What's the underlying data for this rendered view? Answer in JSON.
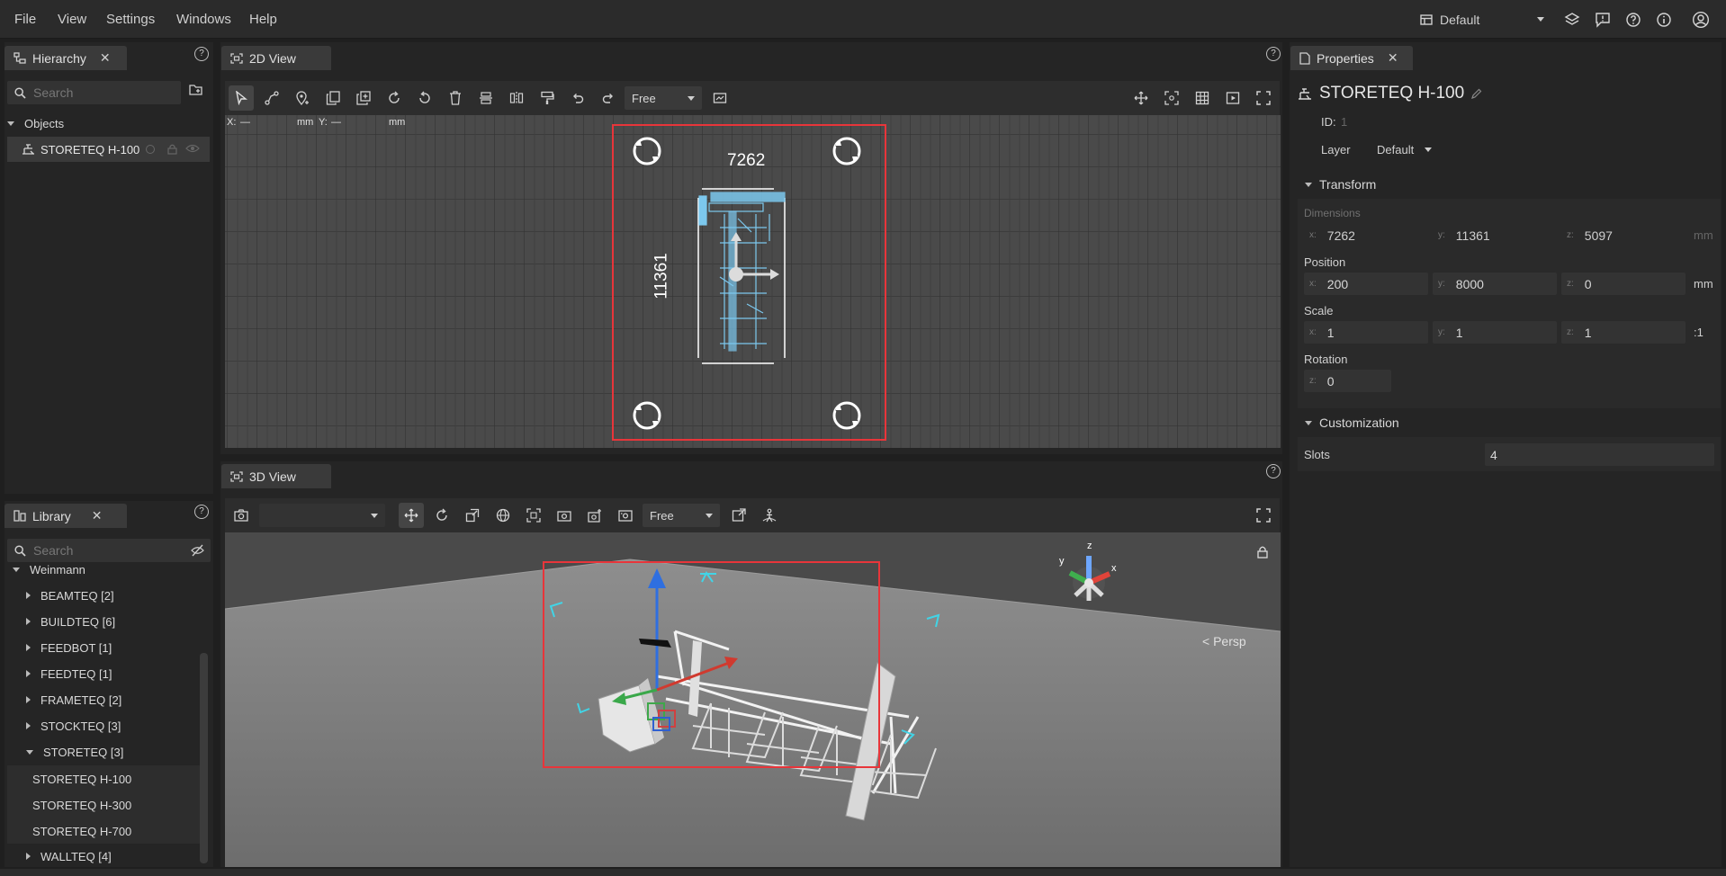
{
  "menubar": {
    "items": [
      "File",
      "View",
      "Settings",
      "Windows",
      "Help"
    ],
    "layout_label": "Default"
  },
  "hierarchy": {
    "tab_label": "Hierarchy",
    "search_placeholder": "Search",
    "group_label": "Objects",
    "items": [
      {
        "label": "STORETEQ H-100"
      }
    ]
  },
  "library": {
    "tab_label": "Library",
    "search_placeholder": "Search",
    "parent_label": "Weinmann",
    "groups": [
      {
        "label": "BEAMTEQ [2]"
      },
      {
        "label": "BUILDTEQ [6]"
      },
      {
        "label": "FEEDBOT [1]"
      },
      {
        "label": "FEEDTEQ [1]"
      },
      {
        "label": "FRAMETEQ [2]"
      },
      {
        "label": "STOCKTEQ [3]"
      },
      {
        "label": "STORETEQ [3]"
      }
    ],
    "children": [
      "STORETEQ H-100",
      "STORETEQ H-300",
      "STORETEQ H-700"
    ],
    "last_group": "WALLTEQ [4]"
  },
  "view2d": {
    "tab_label": "2D View",
    "mode_label": "Free",
    "coords": {
      "x_label": "X:",
      "x_value": "—",
      "x_unit": "mm",
      "y_label": "Y:",
      "y_value": "—",
      "y_unit": "mm"
    },
    "dim_width": "7262",
    "dim_height": "11361"
  },
  "view3d": {
    "tab_label": "3D View",
    "camera_value": "",
    "mode_label": "Free",
    "gizmo_axis_x": "x",
    "gizmo_axis_y": "y",
    "gizmo_axis_z": "z",
    "persp_label": "< Persp"
  },
  "properties": {
    "tab_label": "Properties",
    "title": "STORETEQ H-100",
    "id_label": "ID:",
    "id_value": "1",
    "layer_label": "Layer",
    "layer_value": "Default",
    "transform_label": "Transform",
    "dimensions_label": "Dimensions",
    "dimensions": {
      "x": "7262",
      "y": "11361",
      "z": "5097",
      "unit": "mm"
    },
    "position_label": "Position",
    "position": {
      "x": "200",
      "y": "8000",
      "z": "0",
      "unit": "mm"
    },
    "scale_label": "Scale",
    "scale": {
      "x": "1",
      "y": "1",
      "z": "1",
      "unit": ":1"
    },
    "rotation_label": "Rotation",
    "rotation": {
      "z": "0"
    },
    "customization_label": "Customization",
    "slots_label": "Slots",
    "slots_value": "4"
  },
  "axis_labels": {
    "x": "x:",
    "y": "y:",
    "z": "z:"
  },
  "colors": {
    "accent_selection": "#e8353a",
    "blueprint": "#7cc8ee",
    "background": "#1f1f1f",
    "panel": "#252525"
  }
}
